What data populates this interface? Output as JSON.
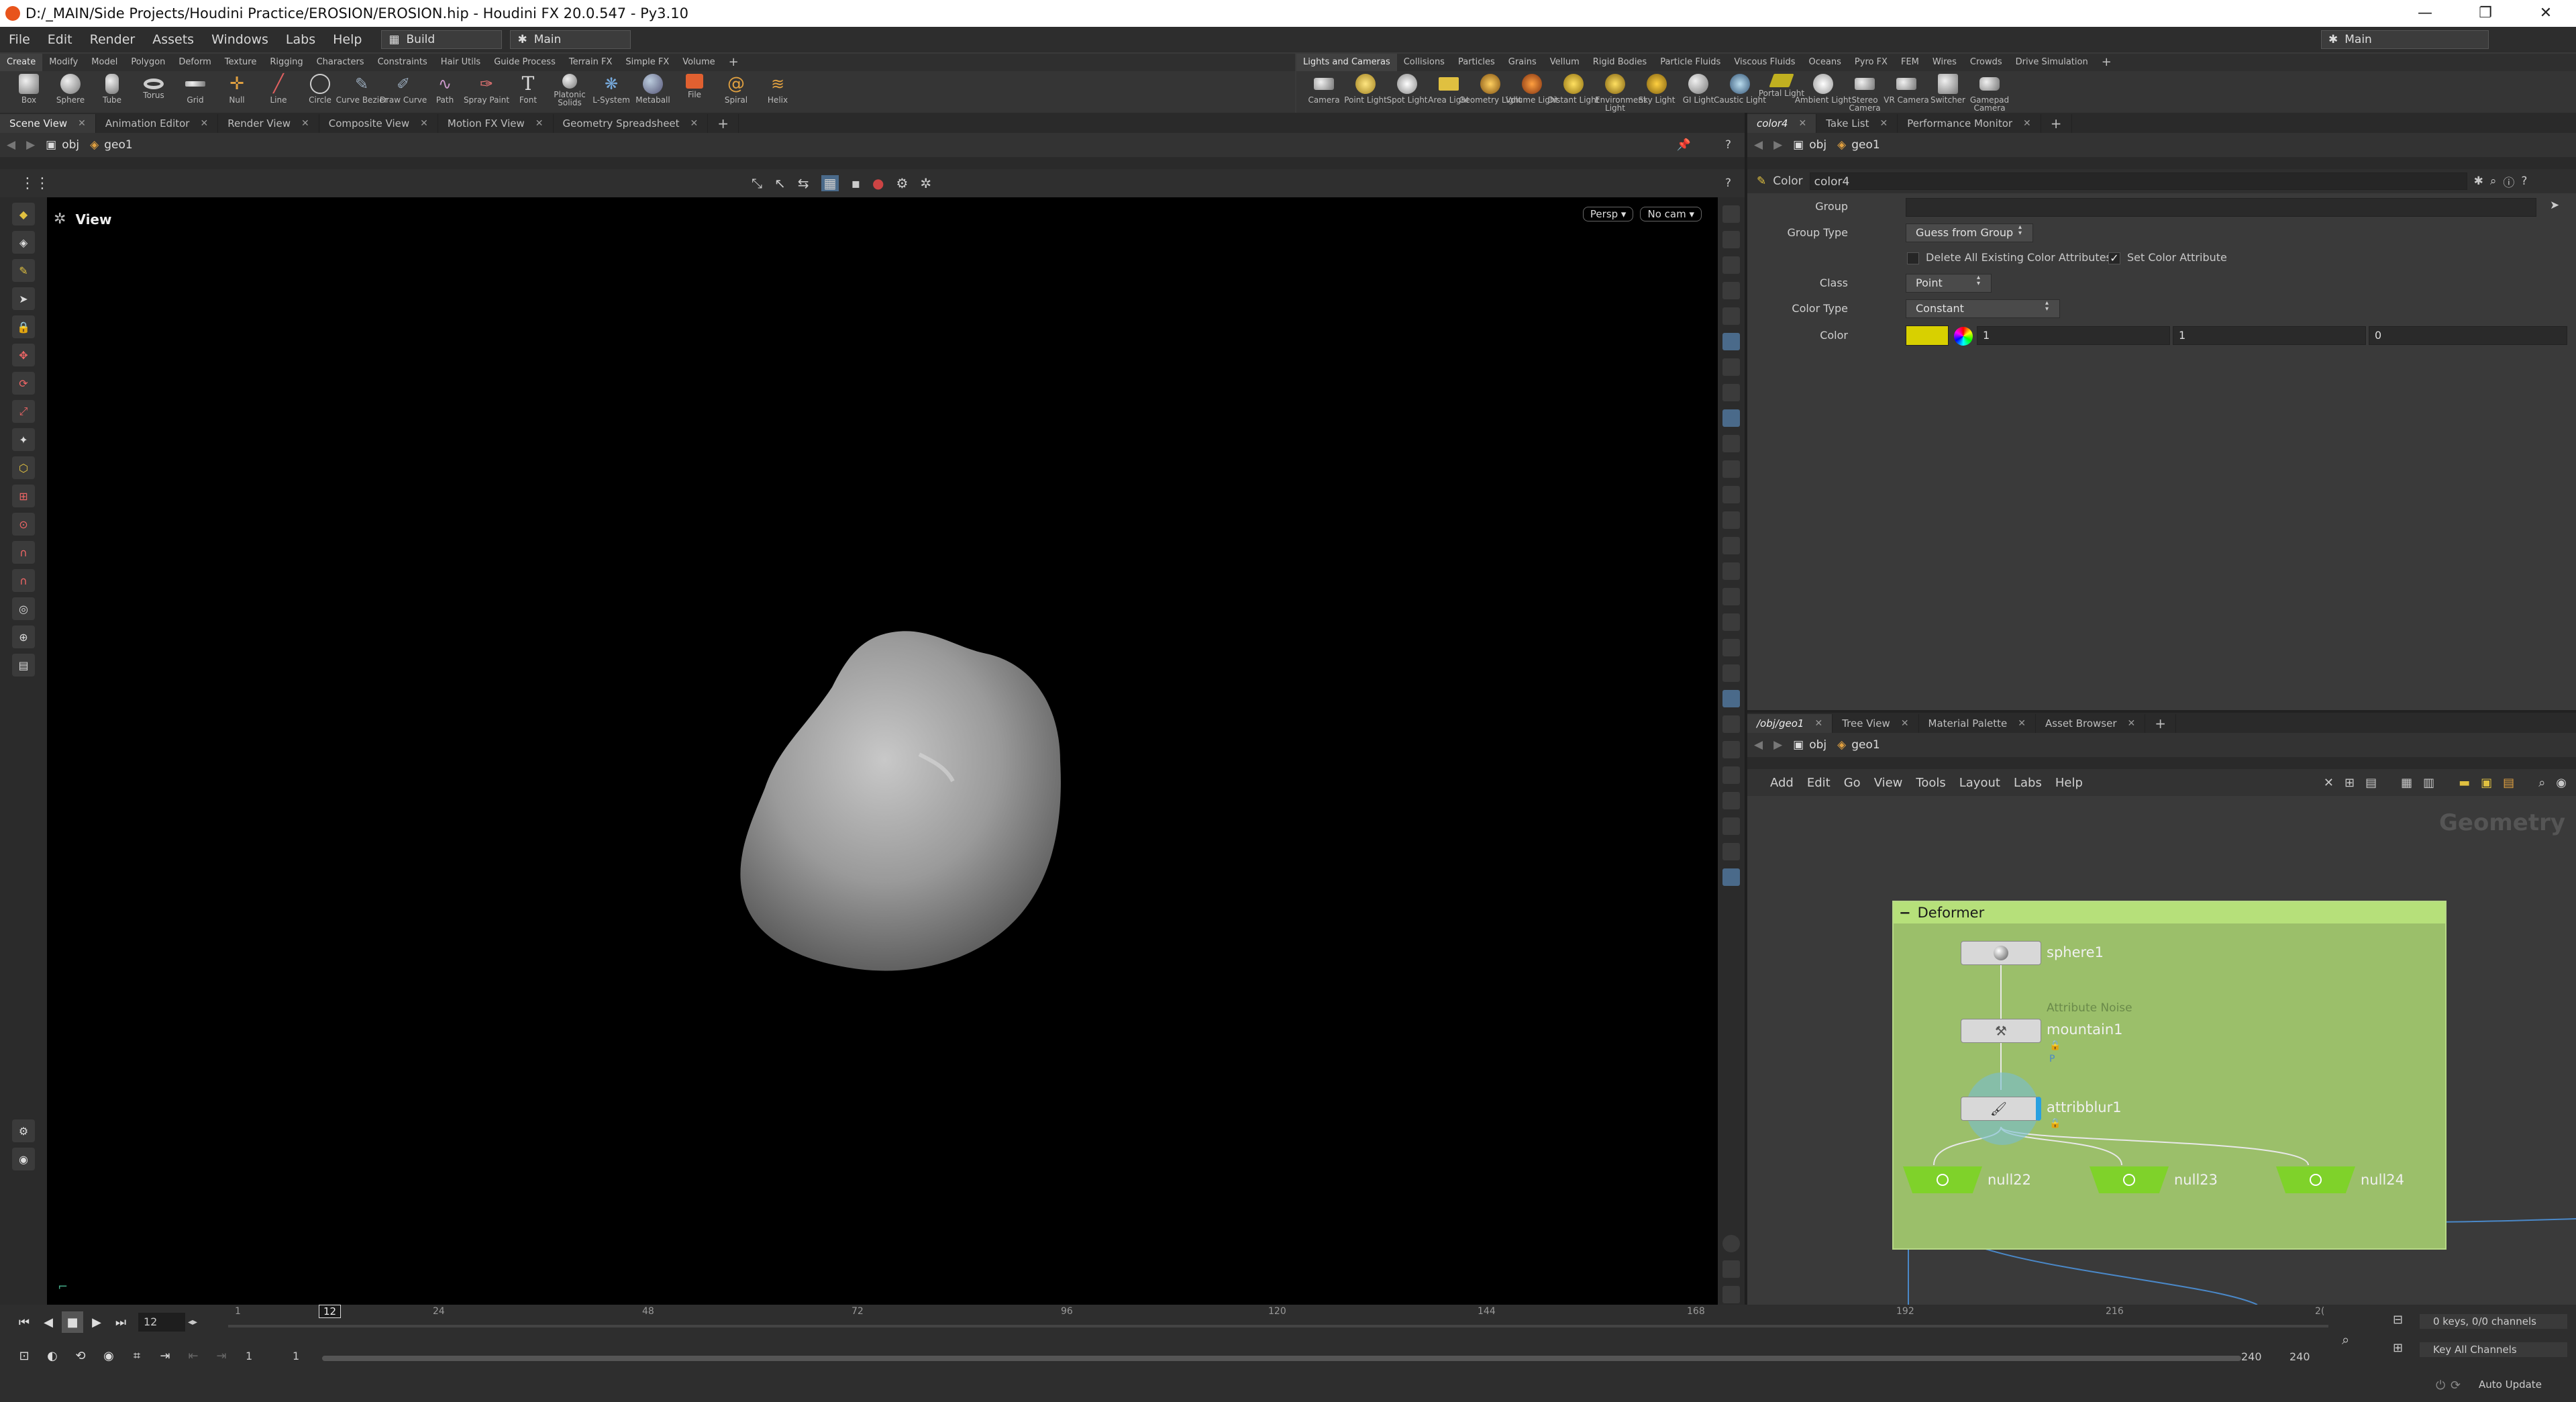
{
  "window": {
    "title": "D:/_MAIN/Side Projects/Houdini Practice/EROSION/EROSION.hip - Houdini FX 20.0.547 - Py3.10",
    "controls": [
      "—",
      "❐",
      "✕"
    ]
  },
  "menubar": {
    "items": [
      "File",
      "Edit",
      "Render",
      "Assets",
      "Windows",
      "Labs",
      "Help"
    ],
    "desktop": "Build",
    "context": "Main",
    "right_context": "Main"
  },
  "shelf_left": {
    "tabs": [
      "Create",
      "Modify",
      "Model",
      "Polygon",
      "Deform",
      "Texture",
      "Rigging",
      "Characters",
      "Constraints",
      "Hair Utils",
      "Guide Process",
      "Terrain FX",
      "Simple FX",
      "Volume"
    ],
    "tools": [
      "Box",
      "Sphere",
      "Tube",
      "Torus",
      "Grid",
      "Null",
      "Line",
      "Circle",
      "Curve Bezier",
      "Draw Curve",
      "Path",
      "Spray Paint",
      "Font",
      "Platonic Solids",
      "L-System",
      "Metaball",
      "File",
      "Spiral",
      "Helix"
    ]
  },
  "shelf_right": {
    "tabs": [
      "Lights and Cameras",
      "Collisions",
      "Particles",
      "Grains",
      "Vellum",
      "Rigid Bodies",
      "Particle Fluids",
      "Viscous Fluids",
      "Oceans",
      "Pyro FX",
      "FEM",
      "Wires",
      "Crowds",
      "Drive Simulation"
    ],
    "tools": [
      "Camera",
      "Point Light",
      "Spot Light",
      "Area Light",
      "Geometry Light",
      "Volume Light",
      "Distant Light",
      "Environment Light",
      "Sky Light",
      "GI Light",
      "Caustic Light",
      "Portal Light",
      "Ambient Light",
      "Stereo Camera",
      "VR Camera",
      "Switcher",
      "Gamepad Camera"
    ]
  },
  "viewport_pane": {
    "tabs": [
      "Scene View",
      "Animation Editor",
      "Render View",
      "Composite View",
      "Motion FX View",
      "Geometry Spreadsheet"
    ],
    "path": [
      "obj",
      "geo1"
    ],
    "view_label": "View",
    "persp": "Persp",
    "cam": "No cam"
  },
  "param_pane": {
    "tabs": [
      "color4",
      "Take List",
      "Performance Monitor"
    ],
    "path": [
      "obj",
      "geo1"
    ],
    "node_type": "Color",
    "node_name": "color4",
    "labels": {
      "group": "Group",
      "group_type": "Group Type",
      "class": "Class",
      "color_type": "Color Type",
      "color": "Color"
    },
    "group_type": "Guess from Group",
    "delete_label": "Delete All Existing Color Attributes",
    "set_label": "Set Color Attribute",
    "class": "Point",
    "color_type": "Constant",
    "color_r": "1",
    "color_g": "1",
    "color_b": "0",
    "swatch": "#d8d000"
  },
  "network_pane": {
    "tabs": [
      "/obj/geo1",
      "Tree View",
      "Material Palette",
      "Asset Browser"
    ],
    "path": [
      "obj",
      "geo1"
    ],
    "menu": [
      "Add",
      "Edit",
      "Go",
      "View",
      "Tools",
      "Layout",
      "Labs",
      "Help"
    ],
    "context_label": "Geometry",
    "box_title": "Deformer",
    "nodes": {
      "sphere": "sphere1",
      "mountain": "mountain1",
      "mountain_type": "Attribute Noise",
      "mountain_flag": "P",
      "blur": "attribblur1",
      "null22": "null22",
      "null23": "null23",
      "null24": "null24"
    }
  },
  "timeline": {
    "current_frame": "12",
    "ticks": [
      "1",
      "24",
      "48",
      "72",
      "96",
      "120",
      "144",
      "168",
      "192",
      "216",
      "2("
    ],
    "marker": "12",
    "start": "1",
    "start2": "1",
    "end": "240",
    "end2": "240",
    "keys": "0 keys, 0/0 channels",
    "key_all": "Key All Channels",
    "auto_update": "Auto Update"
  }
}
